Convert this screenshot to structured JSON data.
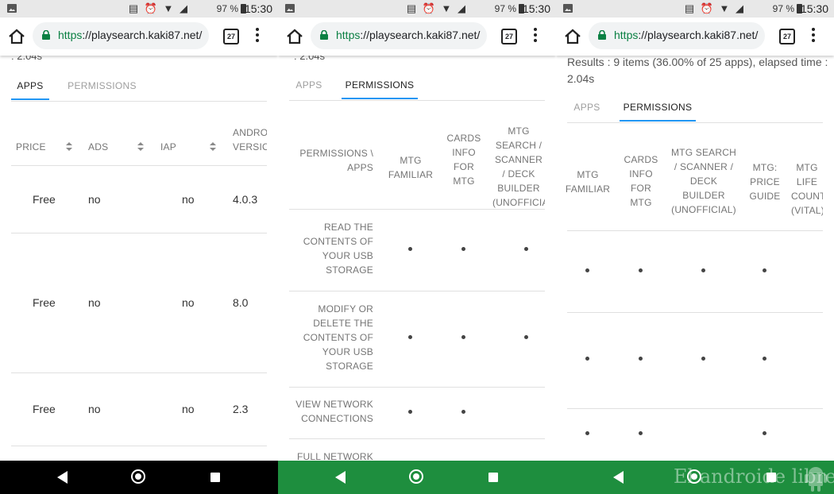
{
  "statusbar": {
    "battery": "97 %",
    "time": "15:30"
  },
  "browser": {
    "url_scheme": "https",
    "url_rest": "://playsearch.kaki87.net/",
    "tab_count": "27"
  },
  "screen1": {
    "partial_text": ": 2.04s",
    "tabs": [
      "APPS",
      "PERMISSIONS"
    ],
    "headers": [
      "PRICE",
      "ADS",
      "IAP",
      "ANDROID VERSION"
    ],
    "rows": [
      {
        "price": "Free",
        "ads": "no",
        "iap": "no",
        "version": "4.0.3"
      },
      {
        "price": "Free",
        "ads": "no",
        "iap": "no",
        "version": "8.0"
      },
      {
        "price": "Free",
        "ads": "no",
        "iap": "no",
        "version": "2.3"
      }
    ]
  },
  "screen2": {
    "partial_text": ": 2.04s",
    "tabs": [
      "APPS",
      "PERMISSIONS"
    ],
    "corner_header": "PERMISSIONS \\ APPS",
    "app_headers": [
      "MTG FAMILIAR",
      "CARDS INFO FOR MTG",
      "MTG SEARCH / SCANNER / DECK BUILDER (UNOFFICIAL)"
    ],
    "permissions": [
      "READ THE CONTENTS OF YOUR USB STORAGE",
      "MODIFY OR DELETE THE CONTENTS OF YOUR USB STORAGE",
      "VIEW NETWORK CONNECTIONS",
      "FULL NETWORK ACCESS"
    ]
  },
  "screen3": {
    "results_text": "Results : 9 items (36.00% of 25 apps), elapsed time : 2.04s",
    "tabs": [
      "APPS",
      "PERMISSIONS"
    ],
    "app_headers": [
      "MTG FAMILIAR",
      "CARDS INFO FOR MTG",
      "MTG SEARCH / SCANNER / DECK BUILDER (UNOFFICIAL)",
      "MTG: PRICE GUIDE",
      "MTG LIFE COUNTER (VITAL)"
    ]
  },
  "watermark": "El androide libre",
  "colors": {
    "nav_black": "#000000",
    "nav_green": "#1e8e3e",
    "nav_white": "#ffffff",
    "tab_accent": "#2196f3",
    "url_green": "#0b8043"
  }
}
